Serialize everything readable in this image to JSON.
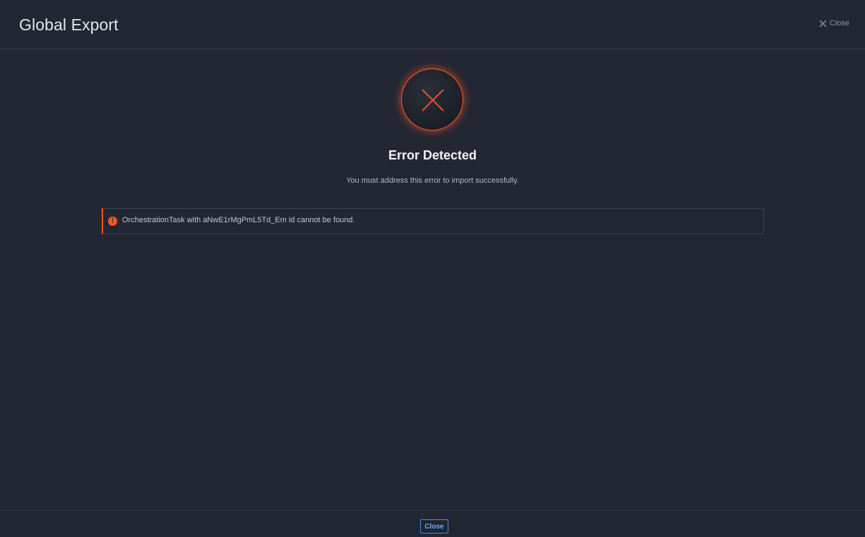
{
  "header": {
    "title": "Global Export",
    "close_label": "Close"
  },
  "error": {
    "heading": "Error Detected",
    "subtext": "You must address this error to import successfully.",
    "message": "OrchestrationTask with aNwE1rMgPmL5Td_Em id cannot be found.",
    "alert_symbol": "!"
  },
  "footer": {
    "close_label": "Close"
  },
  "icons": {
    "header_close": "close-icon",
    "error_badge": "x-icon",
    "alert": "exclamation-circle-icon"
  },
  "colors": {
    "accent_error": "#ff5622",
    "accent_primary": "#4a8fe0",
    "background": "#232733"
  }
}
